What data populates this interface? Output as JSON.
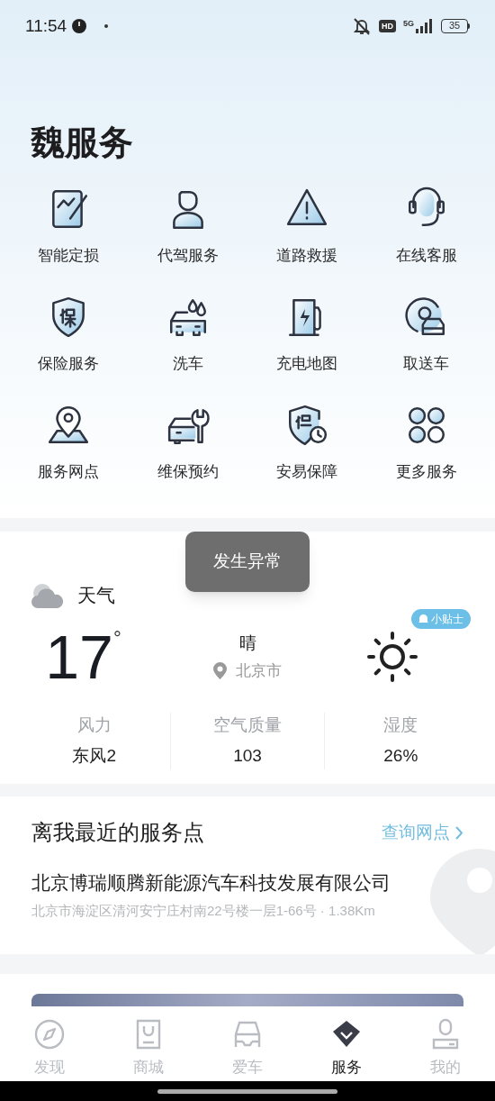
{
  "status_bar": {
    "time": "11:54",
    "hd": "HD",
    "network": "5G",
    "battery": "35"
  },
  "page_title": "魏服务",
  "services": [
    {
      "label": "智能定损"
    },
    {
      "label": "代驾服务"
    },
    {
      "label": "道路救援"
    },
    {
      "label": "在线客服"
    },
    {
      "label": "保险服务"
    },
    {
      "label": "洗车"
    },
    {
      "label": "充电地图"
    },
    {
      "label": "取送车"
    },
    {
      "label": "服务网点"
    },
    {
      "label": "维保预约"
    },
    {
      "label": "安易保障"
    },
    {
      "label": "更多服务"
    }
  ],
  "toast": "发生异常",
  "weather": {
    "title": "天气",
    "temperature": "17",
    "degree": "°",
    "condition": "晴",
    "city": "北京市",
    "tip_badge": "小贴士",
    "stats": [
      {
        "label": "风力",
        "value": "东风2"
      },
      {
        "label": "空气质量",
        "value": "103"
      },
      {
        "label": "湿度",
        "value": "26%"
      }
    ]
  },
  "nearest": {
    "title": "离我最近的服务点",
    "link": "查询网点",
    "name": "北京博瑞顺腾新能源汽车科技发展有限公司",
    "address": "北京市海淀区清河安宁庄村南22号楼一层1-66号 · 1.38Km"
  },
  "tabs": [
    {
      "label": "发现",
      "selected": false
    },
    {
      "label": "商城",
      "selected": false
    },
    {
      "label": "爱车",
      "selected": false
    },
    {
      "label": "服务",
      "selected": true
    },
    {
      "label": "我的",
      "selected": false
    }
  ]
}
